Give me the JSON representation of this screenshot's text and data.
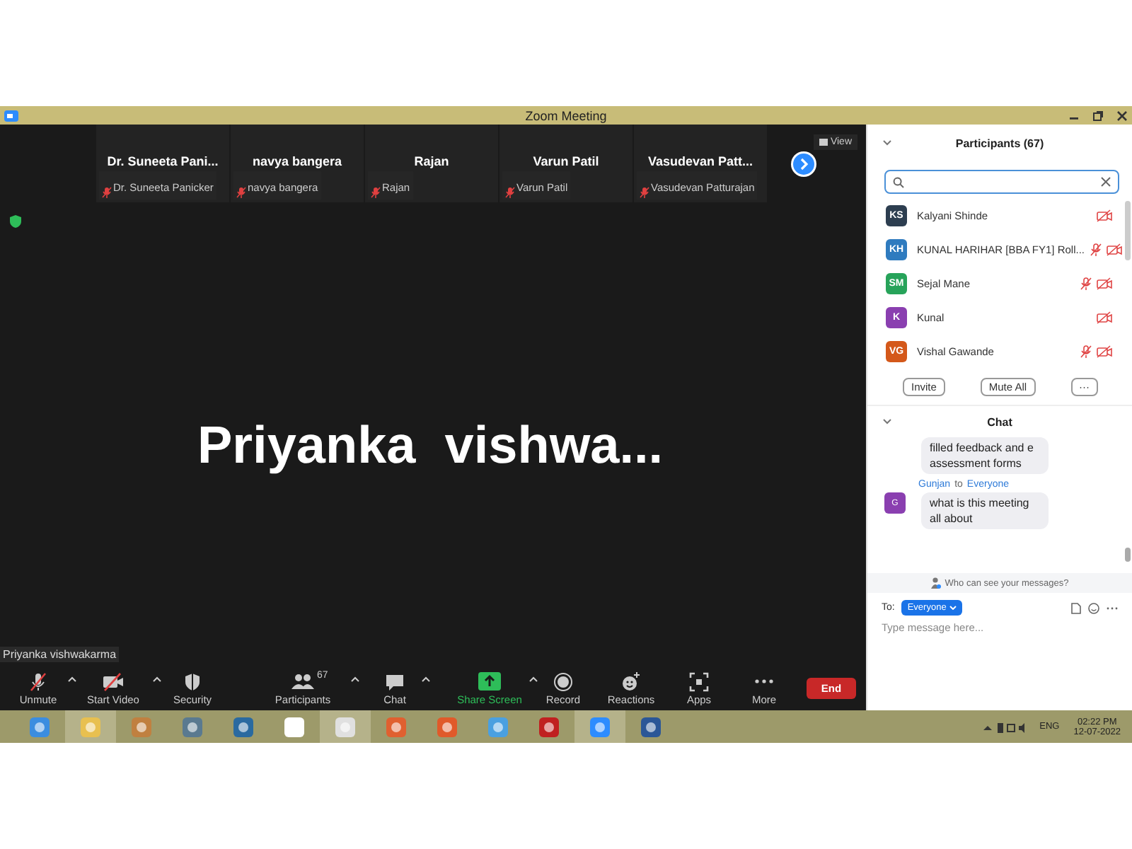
{
  "window": {
    "title": "Zoom Meeting"
  },
  "thumbnails": [
    {
      "name": "Dr. Suneeta Pani...",
      "label": "Dr. Suneeta Panicker"
    },
    {
      "name": "navya bangera",
      "label": "navya bangera"
    },
    {
      "name": "Rajan",
      "label": "Rajan"
    },
    {
      "name": "Varun Patil",
      "label": "Varun Patil"
    },
    {
      "name": "Vasudevan  Patt...",
      "label": "Vasudevan Patturajan"
    }
  ],
  "view_button": "View",
  "speaker": {
    "display_name": "Priyanka  vishwa...",
    "name_label": "Priyanka vishwakarma"
  },
  "toolbar": [
    {
      "kind": "mic",
      "label": "Unmute",
      "caret": true
    },
    {
      "kind": "video",
      "label": "Start Video",
      "caret": true
    },
    {
      "kind": "security",
      "label": "Security",
      "caret": false
    },
    {
      "kind": "participants",
      "label": "Participants",
      "count": "67",
      "caret": true
    },
    {
      "kind": "chat",
      "label": "Chat",
      "caret": true
    },
    {
      "kind": "share",
      "label": "Share Screen",
      "caret": true
    },
    {
      "kind": "record",
      "label": "Record",
      "caret": false
    },
    {
      "kind": "reactions",
      "label": "Reactions",
      "caret": false
    },
    {
      "kind": "apps",
      "label": "Apps",
      "caret": false
    },
    {
      "kind": "more",
      "label": "More",
      "caret": false
    }
  ],
  "end_button": "End",
  "participants": {
    "title": "Participants (67)",
    "items": [
      {
        "initials": "KS",
        "name": "Kalyani Shinde",
        "color": "#2d3e50",
        "audio_muted": false
      },
      {
        "initials": "KH",
        "name": "KUNAL HARIHAR [BBA FY1] Roll...",
        "color": "#2f7bbf",
        "audio_muted": true
      },
      {
        "initials": "SM",
        "name": "Sejal Mane",
        "color": "#27a35a",
        "audio_muted": true
      },
      {
        "initials": "K",
        "name": "Kunal",
        "color": "#8a3fb0",
        "audio_muted": false
      },
      {
        "initials": "VG",
        "name": "Vishal Gawande",
        "color": "#d4581a",
        "audio_muted": true
      }
    ],
    "buttons": [
      "Invite",
      "Mute All",
      "···"
    ]
  },
  "chat": {
    "title": "Chat",
    "messages": [
      {
        "text": "filled feedback and e assessment forms"
      },
      {
        "sender": "Gunjan",
        "recipient": "Everyone",
        "initial": "G",
        "text": "what is this meeting all about"
      }
    ],
    "to_word": "to",
    "visibility_link": "Who can see your messages?",
    "to_label": "To:",
    "recipient": "Everyone",
    "placeholder": "Type message here..."
  },
  "taskbar": {
    "language": "ENG",
    "time": "02:22 PM",
    "date": "12-07-2022"
  }
}
